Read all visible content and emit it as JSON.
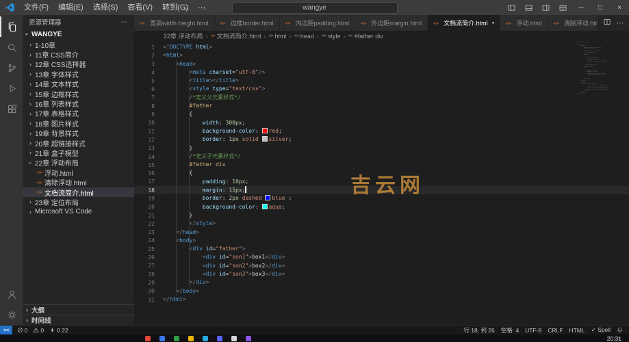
{
  "titlebar": {
    "title": "wangye",
    "menus": [
      "文件(F)",
      "编辑(E)",
      "选择(S)",
      "查看(V)",
      "转到(G)"
    ]
  },
  "icons": {
    "chevron": "›",
    "ellipsis": "⋯",
    "file_html": "<>",
    "modified_dot": "●",
    "close": "×",
    "minimize": "─",
    "maximize": "□",
    "back": "←",
    "forward": "→",
    "separator": "›"
  },
  "activity_bar": {
    "top": [
      {
        "name": "explorer",
        "active": true
      },
      {
        "name": "search",
        "active": false
      },
      {
        "name": "source-control",
        "active": false
      },
      {
        "name": "run-debug",
        "active": false
      },
      {
        "name": "extensions",
        "active": false
      }
    ],
    "bottom": [
      {
        "name": "account",
        "active": false
      },
      {
        "name": "settings",
        "active": false
      }
    ]
  },
  "sidebar": {
    "header": "资源管理器",
    "section": "WANGYE",
    "tree": [
      {
        "label": "1-10章",
        "kind": "folder",
        "expanded": false
      },
      {
        "label": "11章 CSS简介",
        "kind": "folder",
        "expanded": false
      },
      {
        "label": "12章 CSS选择器",
        "kind": "folder",
        "expanded": false
      },
      {
        "label": "13章 字体样式",
        "kind": "folder",
        "expanded": false
      },
      {
        "label": "14章 文本样式",
        "kind": "folder",
        "expanded": false
      },
      {
        "label": "15章 边框样式",
        "kind": "folder",
        "expanded": false
      },
      {
        "label": "16章 列表样式",
        "kind": "folder",
        "expanded": false
      },
      {
        "label": "17章 表格样式",
        "kind": "folder",
        "expanded": false
      },
      {
        "label": "18章 图片样式",
        "kind": "folder",
        "expanded": false
      },
      {
        "label": "19章 背景样式",
        "kind": "folder",
        "expanded": false
      },
      {
        "label": "20章 超链接样式",
        "kind": "folder",
        "expanded": false
      },
      {
        "label": "21章 盒子模型",
        "kind": "folder",
        "expanded": false
      },
      {
        "label": "22章 浮动布局",
        "kind": "folder",
        "expanded": true
      },
      {
        "label": "浮动.html",
        "kind": "file",
        "selected": false
      },
      {
        "label": "清除浮动.html",
        "kind": "file",
        "selected": false
      },
      {
        "label": "文档流简介.html",
        "kind": "file",
        "selected": true
      },
      {
        "label": "23章 定位布局",
        "kind": "folder",
        "expanded": false
      },
      {
        "label": "Microsoft VS Code",
        "kind": "folder",
        "expanded": false
      }
    ],
    "panels": [
      "大纲",
      "时间线"
    ]
  },
  "editor": {
    "tabs": [
      {
        "label": "宽高width height.html",
        "active": false,
        "modified": false
      },
      {
        "label": "边框border.html",
        "active": false,
        "modified": false
      },
      {
        "label": "内边距padding.html",
        "active": false,
        "modified": false
      },
      {
        "label": "外边距margin.html",
        "active": false,
        "modified": false
      },
      {
        "label": "文档流简介.html",
        "active": true,
        "modified": true
      },
      {
        "label": "浮动.html",
        "active": false,
        "modified": false
      },
      {
        "label": "清除浮动.html",
        "active": false,
        "modified": false
      }
    ],
    "breadcrumb": [
      {
        "label": "22章 浮动布局",
        "icon": ""
      },
      {
        "label": "文档流简介.html",
        "icon": "file"
      },
      {
        "label": "html",
        "icon": "tag"
      },
      {
        "label": "head",
        "icon": "tag"
      },
      {
        "label": "style",
        "icon": "tag"
      },
      {
        "label": "#father div",
        "icon": "tag"
      }
    ],
    "cursor": {
      "line": 18,
      "col": 26
    },
    "watermark": "吉云网",
    "lines": [
      [
        [
          "<!",
          "pn"
        ],
        [
          "DOCTYPE",
          "tg"
        ],
        [
          " html",
          "at"
        ],
        [
          ">",
          "pn"
        ]
      ],
      [
        [
          "<",
          "pn"
        ],
        [
          "html",
          "tg"
        ],
        [
          ">",
          "pn"
        ]
      ],
      [
        [
          "    ",
          "pl"
        ],
        [
          "<",
          "pn"
        ],
        [
          "head",
          "tg"
        ],
        [
          ">",
          "pn"
        ]
      ],
      [
        [
          "        ",
          "pl"
        ],
        [
          "<",
          "pn"
        ],
        [
          "meta",
          "tg"
        ],
        [
          " charset",
          "at"
        ],
        [
          "=",
          "pl"
        ],
        [
          "\"utf-8\"",
          "st"
        ],
        [
          "/>",
          "pn"
        ]
      ],
      [
        [
          "        ",
          "pl"
        ],
        [
          "<",
          "pn"
        ],
        [
          "title",
          "tg"
        ],
        [
          "></",
          "pn"
        ],
        [
          "title",
          "tg"
        ],
        [
          ">",
          "pn"
        ]
      ],
      [
        [
          "        ",
          "pl"
        ],
        [
          "<",
          "pn"
        ],
        [
          "style",
          "tg"
        ],
        [
          " type",
          "at"
        ],
        [
          "=",
          "pl"
        ],
        [
          "\"text/css\"",
          "st"
        ],
        [
          ">",
          "pn"
        ]
      ],
      [
        [
          "        ",
          "pl"
        ],
        [
          "/*定义父元素样式*/",
          "cm"
        ]
      ],
      [
        [
          "        ",
          "pl"
        ],
        [
          "#father",
          "se"
        ]
      ],
      [
        [
          "        ",
          "pl"
        ],
        [
          "{",
          "pl"
        ]
      ],
      [
        [
          "            ",
          "pl"
        ],
        [
          "width",
          "pr"
        ],
        [
          ": ",
          "pl"
        ],
        [
          "300px",
          "nu"
        ],
        [
          ";",
          "pl"
        ]
      ],
      [
        [
          "            ",
          "pl"
        ],
        [
          "background-color",
          "pr"
        ],
        [
          ": ",
          "pl"
        ],
        [
          "#ff0000",
          "sw"
        ],
        [
          "red",
          "va"
        ],
        [
          ";",
          "pl"
        ]
      ],
      [
        [
          "            ",
          "pl"
        ],
        [
          "border",
          "pr"
        ],
        [
          ": ",
          "pl"
        ],
        [
          "1px",
          "nu"
        ],
        [
          " ",
          "pl"
        ],
        [
          "solid",
          "va"
        ],
        [
          " ",
          "pl"
        ],
        [
          "#c0c0c0",
          "sw"
        ],
        [
          "silver",
          "va"
        ],
        [
          ";",
          "pl"
        ]
      ],
      [
        [
          "        ",
          "pl"
        ],
        [
          "}",
          "pl"
        ]
      ],
      [
        [
          "        ",
          "pl"
        ],
        [
          "/*定义子元素样式*/",
          "cm"
        ]
      ],
      [
        [
          "        ",
          "pl"
        ],
        [
          "#father",
          "se"
        ],
        [
          " ",
          "pl"
        ],
        [
          "div",
          "se"
        ]
      ],
      [
        [
          "        ",
          "pl"
        ],
        [
          "{",
          "pl"
        ]
      ],
      [
        [
          "            ",
          "pl"
        ],
        [
          "padding",
          "pr"
        ],
        [
          ": ",
          "pl"
        ],
        [
          "10px",
          "nu"
        ],
        [
          ";",
          "pl"
        ]
      ],
      [
        [
          "            ",
          "pl"
        ],
        [
          "margin",
          "pr"
        ],
        [
          ": ",
          "pl"
        ],
        [
          "15px",
          "nu"
        ],
        [
          ";",
          "pl"
        ]
      ],
      [
        [
          "            ",
          "pl"
        ],
        [
          "border",
          "pr"
        ],
        [
          ": ",
          "pl"
        ],
        [
          "2px",
          "nu"
        ],
        [
          " ",
          "pl"
        ],
        [
          "dashed",
          "va"
        ],
        [
          " ",
          "pl"
        ],
        [
          "#0000ff",
          "sw"
        ],
        [
          "blue",
          "va"
        ],
        [
          " ;",
          "pl"
        ]
      ],
      [
        [
          "            ",
          "pl"
        ],
        [
          "background-color",
          "pr"
        ],
        [
          ": ",
          "pl"
        ],
        [
          "#00ffff",
          "sw"
        ],
        [
          "aqua",
          "va"
        ],
        [
          ";",
          "pl"
        ]
      ],
      [
        [
          "        ",
          "pl"
        ],
        [
          "}",
          "pl"
        ]
      ],
      [
        [
          "        ",
          "pl"
        ],
        [
          "</",
          "pn"
        ],
        [
          "style",
          "tg"
        ],
        [
          ">",
          "pn"
        ]
      ],
      [
        [
          "    ",
          "pl"
        ],
        [
          "</",
          "pn"
        ],
        [
          "head",
          "tg"
        ],
        [
          ">",
          "pn"
        ]
      ],
      [
        [
          "    ",
          "pl"
        ],
        [
          "<",
          "pn"
        ],
        [
          "body",
          "tg"
        ],
        [
          ">",
          "pn"
        ]
      ],
      [
        [
          "        ",
          "pl"
        ],
        [
          "<",
          "pn"
        ],
        [
          "div",
          "tg"
        ],
        [
          " id",
          "at"
        ],
        [
          "=",
          "pl"
        ],
        [
          "\"father\"",
          "st"
        ],
        [
          ">",
          "pn"
        ]
      ],
      [
        [
          "            ",
          "pl"
        ],
        [
          "<",
          "pn"
        ],
        [
          "div",
          "tg"
        ],
        [
          " id",
          "at"
        ],
        [
          "=",
          "pl"
        ],
        [
          "\"son1\"",
          "st"
        ],
        [
          ">",
          "pn"
        ],
        [
          "box1",
          "pl"
        ],
        [
          "</",
          "pn"
        ],
        [
          "div",
          "tg"
        ],
        [
          ">",
          "pn"
        ]
      ],
      [
        [
          "            ",
          "pl"
        ],
        [
          "<",
          "pn"
        ],
        [
          "div",
          "tg"
        ],
        [
          " id",
          "at"
        ],
        [
          "=",
          "pl"
        ],
        [
          "\"son2\"",
          "st"
        ],
        [
          ">",
          "pn"
        ],
        [
          "box2",
          "pl"
        ],
        [
          "</",
          "pn"
        ],
        [
          "div",
          "tg"
        ],
        [
          ">",
          "pn"
        ]
      ],
      [
        [
          "            ",
          "pl"
        ],
        [
          "<",
          "pn"
        ],
        [
          "div",
          "tg"
        ],
        [
          " id",
          "at"
        ],
        [
          "=",
          "pl"
        ],
        [
          "\"son3\"",
          "st"
        ],
        [
          ">",
          "pn"
        ],
        [
          "box3",
          "pl"
        ],
        [
          "</",
          "pn"
        ],
        [
          "div",
          "tg"
        ],
        [
          ">",
          "pn"
        ]
      ],
      [
        [
          "        ",
          "pl"
        ],
        [
          "</",
          "pn"
        ],
        [
          "div",
          "tg"
        ],
        [
          ">",
          "pn"
        ]
      ],
      [
        [
          "    ",
          "pl"
        ],
        [
          "</",
          "pn"
        ],
        [
          "body",
          "tg"
        ],
        [
          ">",
          "pn"
        ]
      ],
      [
        [
          "</",
          "pn"
        ],
        [
          "html",
          "tg"
        ],
        [
          ">",
          "pn"
        ]
      ]
    ]
  },
  "status_bar": {
    "remote": "><",
    "left": [
      {
        "name": "errors",
        "icon": "error-circle",
        "label": "0"
      },
      {
        "name": "warnings",
        "icon": "warning",
        "label": "0"
      },
      {
        "name": "counter",
        "icon": "zap",
        "label": "0 22"
      }
    ],
    "right": [
      "行 18, 列 26",
      "空格: 4",
      "UTF-8",
      "CRLF",
      "HTML",
      "✓ Spell"
    ]
  },
  "taskbar": {
    "icons": [
      "#e0483e",
      "#3a76f0",
      "#2ea043",
      "#f2b705",
      "#29a8e0",
      "#5865f2",
      "#d8d8d8",
      "#8957e5"
    ],
    "clock": "20:31"
  }
}
